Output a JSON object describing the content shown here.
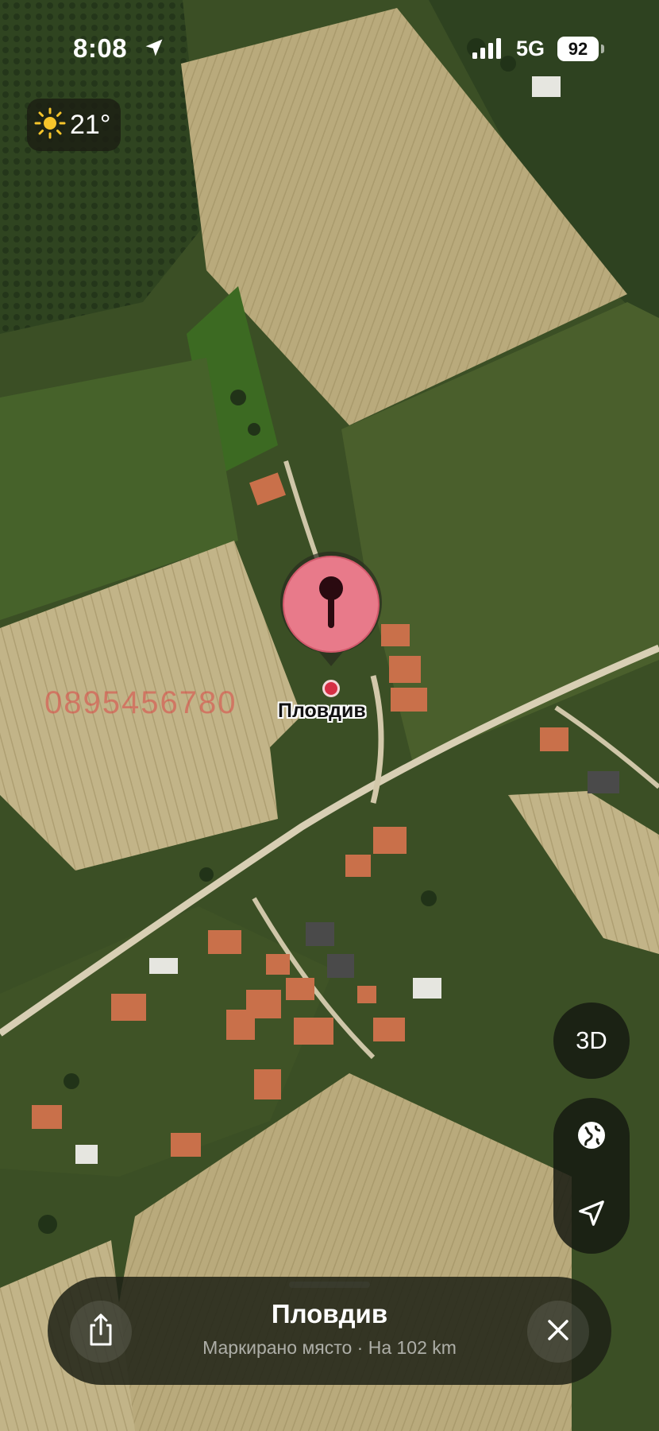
{
  "status_bar": {
    "time": "8:08",
    "network": "5G",
    "battery": "92"
  },
  "weather": {
    "temperature": "21°",
    "icon": "sun-icon"
  },
  "map": {
    "pin_label": "Пловдив",
    "watermark": "0895456780",
    "colors": {
      "pin": "#e87a8a",
      "pin_glyph": "#2a0a10",
      "field": "#b8a878",
      "grass": "#3f5a26"
    }
  },
  "controls": {
    "view_3d_label": "3D",
    "globe_icon": "globe-icon",
    "locate_icon": "location-arrow-icon"
  },
  "place_card": {
    "title": "Пловдив",
    "subtitle": "Маркирано място · На 102 km",
    "share_icon": "share-icon",
    "close_icon": "close-icon"
  }
}
